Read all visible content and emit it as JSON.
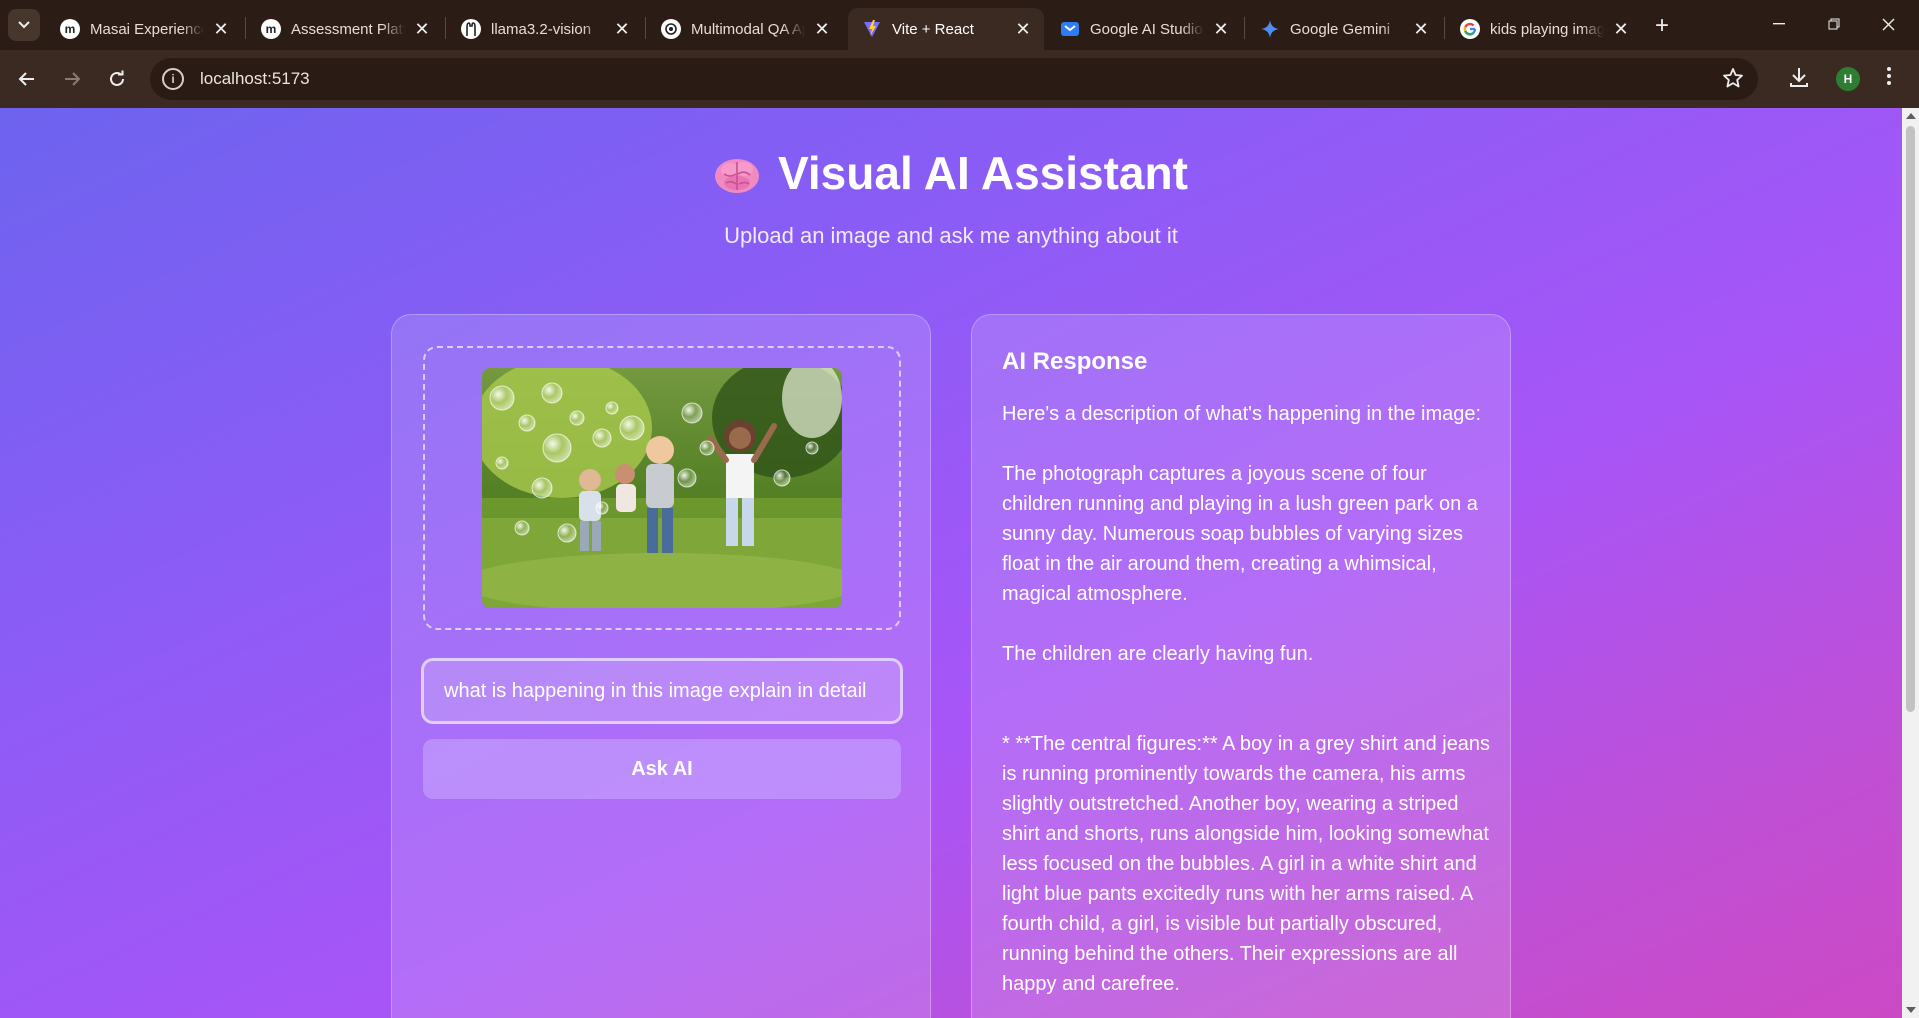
{
  "browser": {
    "tabs": [
      {
        "title": "Masai Experience",
        "favicon": "masai-m-icon"
      },
      {
        "title": "Assessment Platform",
        "favicon": "masai-m-icon"
      },
      {
        "title": "llama3.2-vision",
        "favicon": "ollama-llama-icon"
      },
      {
        "title": "Multimodal QA App",
        "favicon": "openai-icon"
      },
      {
        "title": "Vite + React",
        "favicon": "vite-icon",
        "active": true
      },
      {
        "title": "Google AI Studio",
        "favicon": "ai-studio-icon"
      },
      {
        "title": "Google Gemini",
        "favicon": "gemini-sparkle-icon"
      },
      {
        "title": "kids playing images",
        "favicon": "google-g-icon"
      }
    ],
    "url": "localhost:5173",
    "profile_initial": "H"
  },
  "app": {
    "title": "Visual AI Assistant",
    "subtitle": "Upload an image and ask me anything about it",
    "title_icon": "brain-icon",
    "question_value": "what is happening in this image explain in detail",
    "ask_button": "Ask AI",
    "response": {
      "heading": "AI Response",
      "paragraphs": [
        "Here's a description of what's happening in the image:",
        "The photograph captures a joyous scene of four children running and playing in a lush green park on a sunny day.  Numerous soap bubbles of varying sizes float in the air around them, creating a whimsical, magical atmosphere.",
        "The children are clearly having fun.",
        "* **The central figures:**  A boy in a grey shirt and jeans is running prominently towards the camera, his arms slightly outstretched. Another boy, wearing a striped shirt and shorts, runs alongside him, looking somewhat less focused on the bubbles.  A girl in a white shirt and light blue pants excitedly runs with her arms raised. A fourth child, a girl, is visible but partially obscured, running behind the others.  Their expressions are all happy and carefree."
      ]
    }
  },
  "colors": {
    "gradient_start": "#6d63ef",
    "gradient_end": "#cc49c5",
    "browser_frame": "#2b1d16",
    "toolbar": "#3b2a21"
  }
}
